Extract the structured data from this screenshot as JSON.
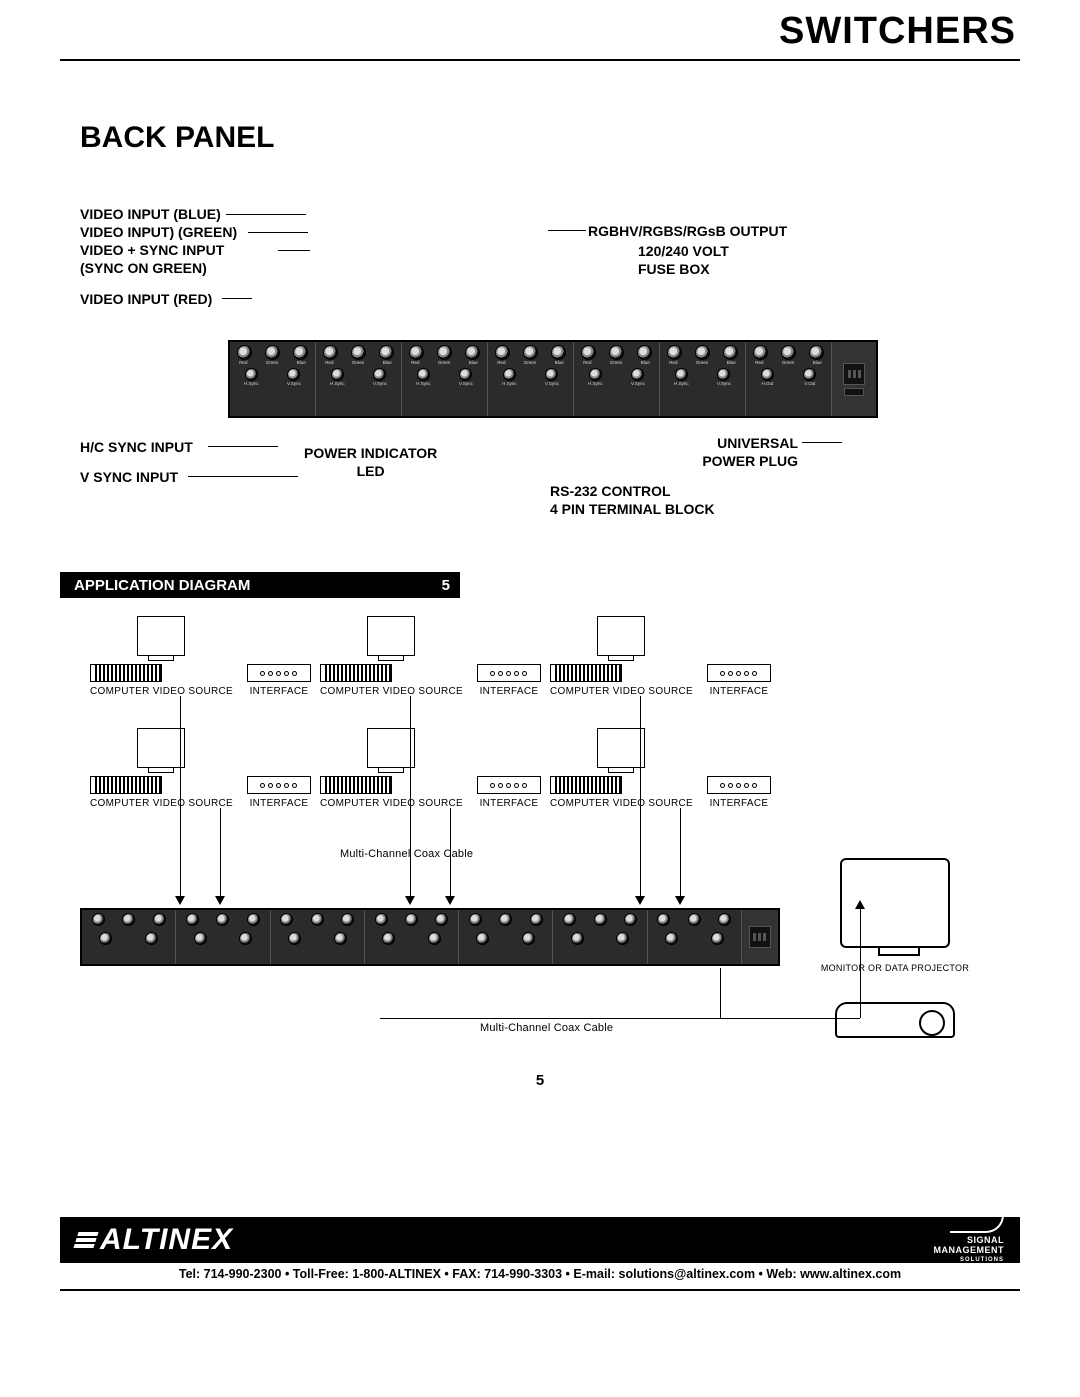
{
  "header": {
    "category": "SWITCHERS"
  },
  "section": {
    "title": "BACK PANEL"
  },
  "callouts": {
    "left_top": "VIDEO INPUT (BLUE)\nVIDEO INPUT) (GREEN)\nVIDEO + SYNC INPUT\n(SYNC ON GREEN)",
    "left_mid": "VIDEO INPUT (RED)",
    "left_low1": "H/C SYNC INPUT",
    "left_low2": "V SYNC INPUT",
    "center_low": "POWER INDICATOR\nLED",
    "right_top": "RGBHV/RGBS/RGsB OUTPUT",
    "right_mid1": "120/240 VOLT\nFUSE BOX",
    "right_low1": "UNIVERSAL\nPOWER PLUG",
    "right_low2": "RS-232 CONTROL\n4 PIN TERMINAL BLOCK"
  },
  "bar": {
    "title": "APPLICATION DIAGRAM",
    "num": "5"
  },
  "app": {
    "computer_label": "Computer\nVideo\nSource",
    "interface_label": "Interface",
    "cable_label": "Multi-Channel Coax Cable",
    "output_label": "Monitor\nOr\nData Projector"
  },
  "page_number": "5",
  "footer": {
    "brand": "ALTINEX",
    "sms_line1": "SIGNAL",
    "sms_line2": "MANAGEMENT",
    "sms_line3": "SOLUTIONS",
    "contact": "Tel: 714-990-2300 • Toll-Free: 1-800-ALTINEX • FAX: 714-990-3303 • E-mail: solutions@altinex.com • Web: www.altinex.com"
  }
}
